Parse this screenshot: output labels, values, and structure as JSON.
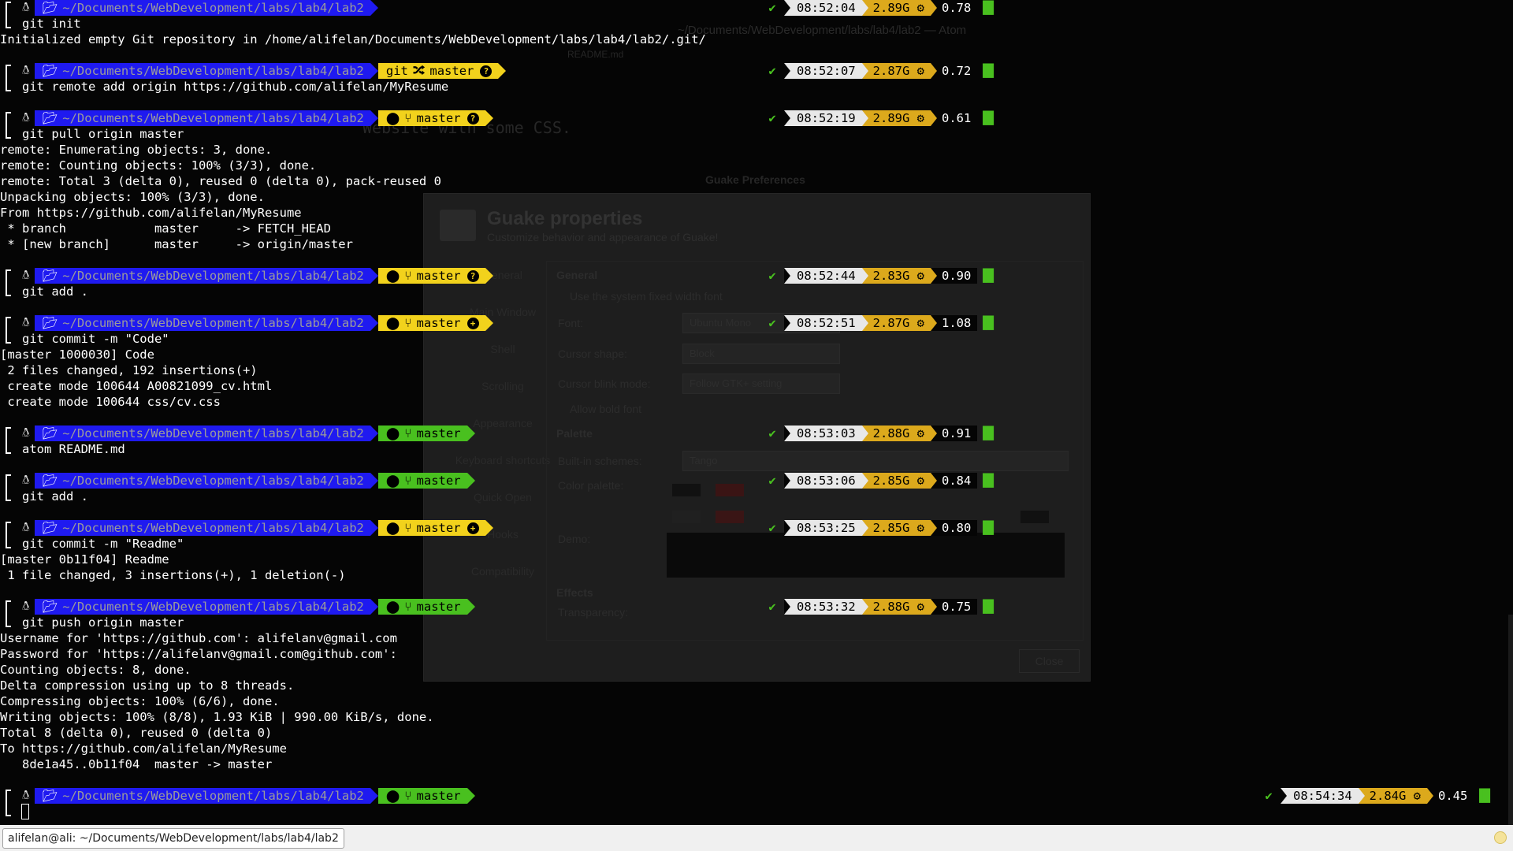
{
  "background": {
    "window_title": "~/Documents/WebDevelopment/labs/lab4/lab2 — Atom",
    "tab": "README.md",
    "code_line": "Website with some CSS.",
    "dialog_title": "Guake Preferences",
    "dialog_heading": "Guake properties",
    "dialog_subtitle": "Customize behavior and appearance of Guake!",
    "dialog_sidebar": [
      "General",
      "Main Window",
      "Shell",
      "Scrolling",
      "Appearance",
      "Keyboard shortcuts",
      "Quick Open",
      "Hooks",
      "Compatibility"
    ],
    "labels": [
      "General",
      "Use the system fixed width font",
      "Font:",
      "Cursor shape:",
      "Cursor blink mode:",
      "Allow bold font",
      "Palette",
      "Built-in schemes:",
      "Color palette:",
      "Demo:",
      "Effects",
      "Transparency:"
    ],
    "font_value": "Ubuntu Mono",
    "cursor_shape": "Block",
    "cursor_blink": "Follow GTK+ setting",
    "scheme": "Tango",
    "close_button": "Close"
  },
  "prompt": {
    "os_icon": "tux-icon",
    "folder_icon": "folder-icon",
    "path": "~/Documents/WebDevelopment/labs/lab4/lab2",
    "branch": "master",
    "git_label": "git",
    "branch_icon": "branch-icon",
    "github_icon": "github-icon"
  },
  "blocks": [
    {
      "vcs": "none",
      "command": "git init",
      "status": {
        "time": "08:52:04",
        "mem": "2.89G",
        "load": "0.78"
      },
      "output": [
        "Initialized empty Git repository in /home/alifelan/Documents/WebDevelopment/labs/lab4/lab2/.git/"
      ]
    },
    {
      "vcs": "git",
      "command": "git remote add origin https://github.com/alifelan/MyResume",
      "status": {
        "time": "08:52:07",
        "mem": "2.87G",
        "load": "0.72"
      },
      "output": []
    },
    {
      "vcs": "github-yellow-q",
      "command": "git pull origin master",
      "status": {
        "time": "08:52:19",
        "mem": "2.89G",
        "load": "0.61"
      },
      "output": [
        "remote: Enumerating objects: 3, done.",
        "remote: Counting objects: 100% (3/3), done.",
        "remote: Total 3 (delta 0), reused 0 (delta 0), pack-reused 0",
        "Unpacking objects: 100% (3/3), done.",
        "From https://github.com/alifelan/MyResume",
        " * branch            master     -> FETCH_HEAD",
        " * [new branch]      master     -> origin/master"
      ]
    },
    {
      "vcs": "github-yellow-q",
      "command": "git add .",
      "status": {
        "time": "08:52:44",
        "mem": "2.83G",
        "load": "0.90"
      },
      "output": []
    },
    {
      "vcs": "github-yellow-plus",
      "command": "git commit -m \"Code\"",
      "status": {
        "time": "08:52:51",
        "mem": "2.87G",
        "load": "1.08"
      },
      "output": [
        "[master 1000030] Code",
        " 2 files changed, 192 insertions(+)",
        " create mode 100644 A00821099_cv.html",
        " create mode 100644 css/cv.css"
      ]
    },
    {
      "vcs": "github-green",
      "command": "atom README.md",
      "status": {
        "time": "08:53:03",
        "mem": "2.88G",
        "load": "0.91"
      },
      "output": []
    },
    {
      "vcs": "github-green",
      "command": "git add .",
      "status": {
        "time": "08:53:06",
        "mem": "2.85G",
        "load": "0.84"
      },
      "output": []
    },
    {
      "vcs": "github-yellow-plus",
      "command": "git commit -m \"Readme\"",
      "status": {
        "time": "08:53:25",
        "mem": "2.85G",
        "load": "0.80"
      },
      "output": [
        "[master 0b11f04] Readme",
        " 1 file changed, 3 insertions(+), 1 deletion(-)"
      ]
    },
    {
      "vcs": "github-green",
      "command": "git push origin master",
      "status": {
        "time": "08:53:32",
        "mem": "2.88G",
        "load": "0.75"
      },
      "output": [
        "Username for 'https://github.com': alifelanv@gmail.com",
        "Password for 'https://alifelanv@gmail.com@github.com':",
        "Counting objects: 8, done.",
        "Delta compression using up to 8 threads.",
        "Compressing objects: 100% (6/6), done.",
        "Writing objects: 100% (8/8), 1.93 KiB | 990.00 KiB/s, done.",
        "Total 8 (delta 0), reused 0 (delta 0)",
        "To https://github.com/alifelan/MyResume",
        "   8de1a45..0b11f04  master -> master"
      ]
    },
    {
      "vcs": "github-green",
      "command": "",
      "status": {
        "time": "08:54:34",
        "mem": "2.84G",
        "load": "0.45"
      },
      "output": [],
      "status_far_right": true
    }
  ],
  "statusbar": {
    "text": "alifelan@ali: ~/Documents/WebDevelopment/labs/lab4/lab2"
  },
  "colors": {
    "path_bg": "#1f1af0",
    "vcs_yellow": "#f2d21c",
    "vcs_green": "#49c01f",
    "time_bg": "#e8e8e8",
    "mem_bg": "#dca91c"
  }
}
